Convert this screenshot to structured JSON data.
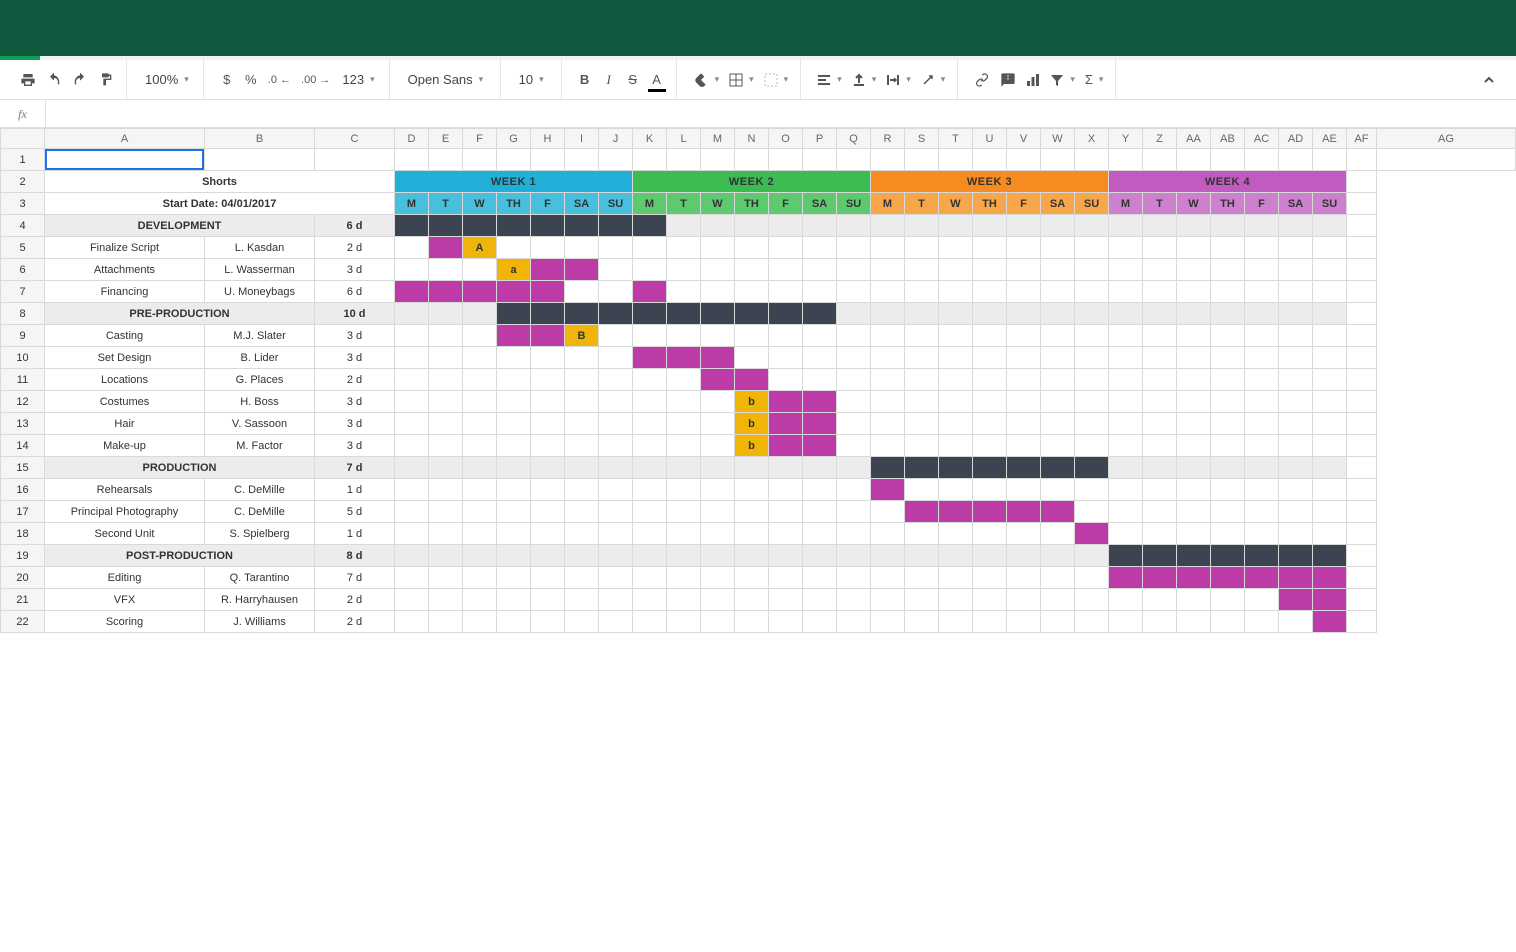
{
  "toolbar": {
    "zoom": "100%",
    "font": "Open Sans",
    "fontSize": "10"
  },
  "columns": [
    "A",
    "B",
    "C",
    "D",
    "E",
    "F",
    "G",
    "H",
    "I",
    "J",
    "K",
    "L",
    "M",
    "N",
    "O",
    "P",
    "Q",
    "R",
    "S",
    "T",
    "U",
    "V",
    "W",
    "X",
    "Y",
    "Z",
    "AA",
    "AB",
    "AC",
    "AD",
    "AE",
    "AF",
    "AG"
  ],
  "rowNumbers": [
    "1",
    "2",
    "3",
    "4",
    "5",
    "6",
    "7",
    "8",
    "9",
    "10",
    "11",
    "12",
    "13",
    "14",
    "15",
    "16",
    "17",
    "18",
    "19",
    "20",
    "21",
    "22"
  ],
  "title": "Shorts",
  "startLabel": "Start Date: 04/01/2017",
  "weeks": [
    "WEEK 1",
    "WEEK 2",
    "WEEK 3",
    "WEEK 4"
  ],
  "days": [
    "M",
    "T",
    "W",
    "TH",
    "F",
    "SA",
    "SU"
  ],
  "rows": [
    {
      "type": "phase",
      "name": "DEVELOPMENT",
      "dur": "6 d",
      "bar": {
        "start": 0,
        "end": 7,
        "class": "g-dark"
      }
    },
    {
      "type": "task",
      "name": "Finalize Script",
      "owner": "L. Kasdan",
      "dur": "2 d",
      "segments": [
        {
          "start": 1,
          "end": 1,
          "class": "g-task"
        },
        {
          "start": 2,
          "end": 2,
          "class": "g-mile",
          "label": "A"
        }
      ]
    },
    {
      "type": "task",
      "name": "Attachments",
      "owner": "L. Wasserman",
      "dur": "3 d",
      "segments": [
        {
          "start": 3,
          "end": 3,
          "class": "g-mile",
          "label": "a"
        },
        {
          "start": 4,
          "end": 5,
          "class": "g-task"
        }
      ]
    },
    {
      "type": "task",
      "name": "Financing",
      "owner": "U. Moneybags",
      "dur": "6 d",
      "segments": [
        {
          "start": 0,
          "end": 4,
          "class": "g-task"
        },
        {
          "start": 7,
          "end": 7,
          "class": "g-task"
        }
      ]
    },
    {
      "type": "phase",
      "name": "PRE-PRODUCTION",
      "dur": "10 d",
      "bar": {
        "start": 3,
        "end": 12,
        "class": "g-dark"
      }
    },
    {
      "type": "task",
      "name": "Casting",
      "owner": "M.J. Slater",
      "dur": "3 d",
      "segments": [
        {
          "start": 3,
          "end": 4,
          "class": "g-task"
        },
        {
          "start": 5,
          "end": 5,
          "class": "g-mile",
          "label": "B"
        }
      ]
    },
    {
      "type": "task",
      "name": "Set Design",
      "owner": "B. Lider",
      "dur": "3 d",
      "segments": [
        {
          "start": 7,
          "end": 9,
          "class": "g-task"
        }
      ]
    },
    {
      "type": "task",
      "name": "Locations",
      "owner": "G. Places",
      "dur": "2 d",
      "segments": [
        {
          "start": 9,
          "end": 10,
          "class": "g-task"
        }
      ]
    },
    {
      "type": "task",
      "name": "Costumes",
      "owner": "H. Boss",
      "dur": "3 d",
      "segments": [
        {
          "start": 10,
          "end": 10,
          "class": "g-mile",
          "label": "b"
        },
        {
          "start": 11,
          "end": 12,
          "class": "g-task"
        }
      ]
    },
    {
      "type": "task",
      "name": "Hair",
      "owner": "V. Sassoon",
      "dur": "3 d",
      "segments": [
        {
          "start": 10,
          "end": 10,
          "class": "g-mile",
          "label": "b"
        },
        {
          "start": 11,
          "end": 12,
          "class": "g-task"
        }
      ]
    },
    {
      "type": "task",
      "name": "Make-up",
      "owner": "M. Factor",
      "dur": "3 d",
      "segments": [
        {
          "start": 10,
          "end": 10,
          "class": "g-mile",
          "label": "b"
        },
        {
          "start": 11,
          "end": 12,
          "class": "g-task"
        }
      ]
    },
    {
      "type": "phase",
      "name": "PRODUCTION",
      "dur": "7 d",
      "bar": {
        "start": 14,
        "end": 20,
        "class": "g-dark"
      }
    },
    {
      "type": "task",
      "name": "Rehearsals",
      "owner": "C. DeMille",
      "dur": "1 d",
      "segments": [
        {
          "start": 14,
          "end": 14,
          "class": "g-task"
        }
      ]
    },
    {
      "type": "task",
      "name": "Principal Photography",
      "owner": "C. DeMille",
      "dur": "5 d",
      "segments": [
        {
          "start": 15,
          "end": 19,
          "class": "g-task"
        }
      ]
    },
    {
      "type": "task",
      "name": "Second Unit",
      "owner": "S. Spielberg",
      "dur": "1 d",
      "segments": [
        {
          "start": 20,
          "end": 20,
          "class": "g-task"
        }
      ]
    },
    {
      "type": "phase",
      "name": "POST-PRODUCTION",
      "dur": "8 d",
      "bar": {
        "start": 21,
        "end": 27,
        "class": "g-dark"
      }
    },
    {
      "type": "task",
      "name": "Editing",
      "owner": "Q. Tarantino",
      "dur": "7 d",
      "segments": [
        {
          "start": 21,
          "end": 27,
          "class": "g-task"
        }
      ]
    },
    {
      "type": "task",
      "name": "VFX",
      "owner": "R. Harryhausen",
      "dur": "2 d",
      "segments": [
        {
          "start": 26,
          "end": 27,
          "class": "g-task"
        }
      ]
    },
    {
      "type": "task",
      "name": "Scoring",
      "owner": "J. Williams",
      "dur": "2 d",
      "segments": [
        {
          "start": 27,
          "end": 27,
          "class": "g-task"
        }
      ]
    }
  ]
}
